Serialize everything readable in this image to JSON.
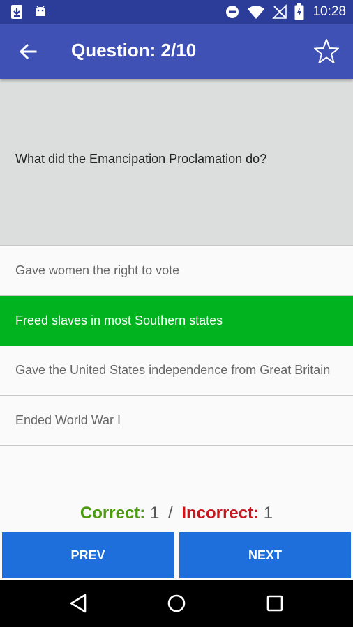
{
  "status_bar": {
    "time": "10:28",
    "icons": [
      "download-icon",
      "android-icon",
      "do-not-disturb-icon",
      "wifi-icon",
      "no-signal-icon",
      "battery-charging-icon"
    ]
  },
  "app_bar": {
    "title": "Question: 2/10",
    "back_icon": "arrow-back-icon",
    "favorite_icon": "star-outline-icon"
  },
  "question": {
    "text": "What did the Emancipation Proclamation do?"
  },
  "answers": [
    {
      "label": "Gave women the right to vote",
      "selected": false
    },
    {
      "label": "Freed slaves in most Southern states",
      "selected": true
    },
    {
      "label": "Gave the United States independence from Great Britain",
      "selected": false
    },
    {
      "label": "Ended World War I",
      "selected": false
    }
  ],
  "score": {
    "correct_label": "Correct:",
    "correct_value": "1",
    "separator": "/",
    "incorrect_label": "Incorrect:",
    "incorrect_value": "1"
  },
  "buttons": {
    "prev": "PREV",
    "next": "NEXT"
  },
  "colors": {
    "status_bar": "#2b3d99",
    "app_bar": "#3f51b5",
    "selected_answer": "#00b31f",
    "correct": "#4c9a0e",
    "incorrect": "#c8181e",
    "nav_button": "#1e6fdc"
  },
  "system_nav": {
    "icons": [
      "back-triangle-icon",
      "home-circle-icon",
      "recents-square-icon"
    ]
  }
}
